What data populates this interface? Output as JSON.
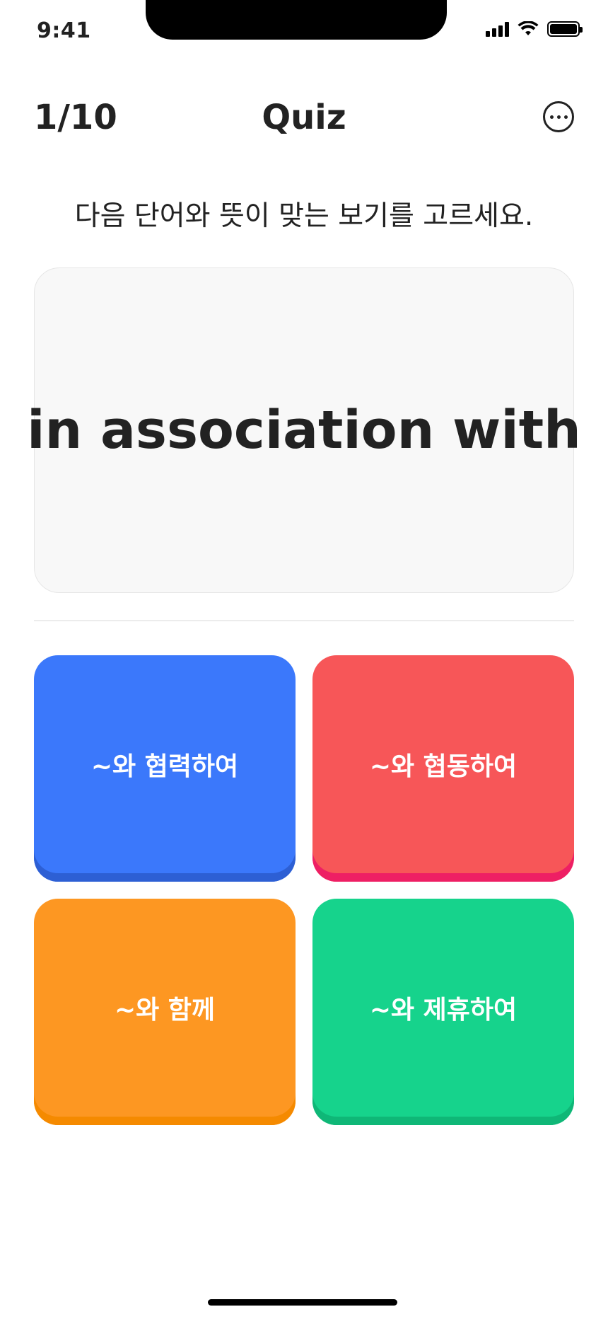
{
  "status_bar": {
    "time": "9:41"
  },
  "header": {
    "progress": "1/10",
    "title": "Quiz",
    "more_icon": "ellipsis-circle-icon"
  },
  "instruction": "다음 단어와 뜻이 맞는 보기를 고르세요.",
  "question": {
    "word": "in association with"
  },
  "options": [
    {
      "label": "~와 협력하여",
      "color": "#3b78fb",
      "shadow": "#2d5fd4"
    },
    {
      "label": "~와 협동하여",
      "color": "#f75658",
      "shadow": "#ee1f64"
    },
    {
      "label": "~와 함께",
      "color": "#fd9722",
      "shadow": "#f58a00"
    },
    {
      "label": "~와 제휴하여",
      "color": "#16d38c",
      "shadow": "#0fb777"
    }
  ]
}
